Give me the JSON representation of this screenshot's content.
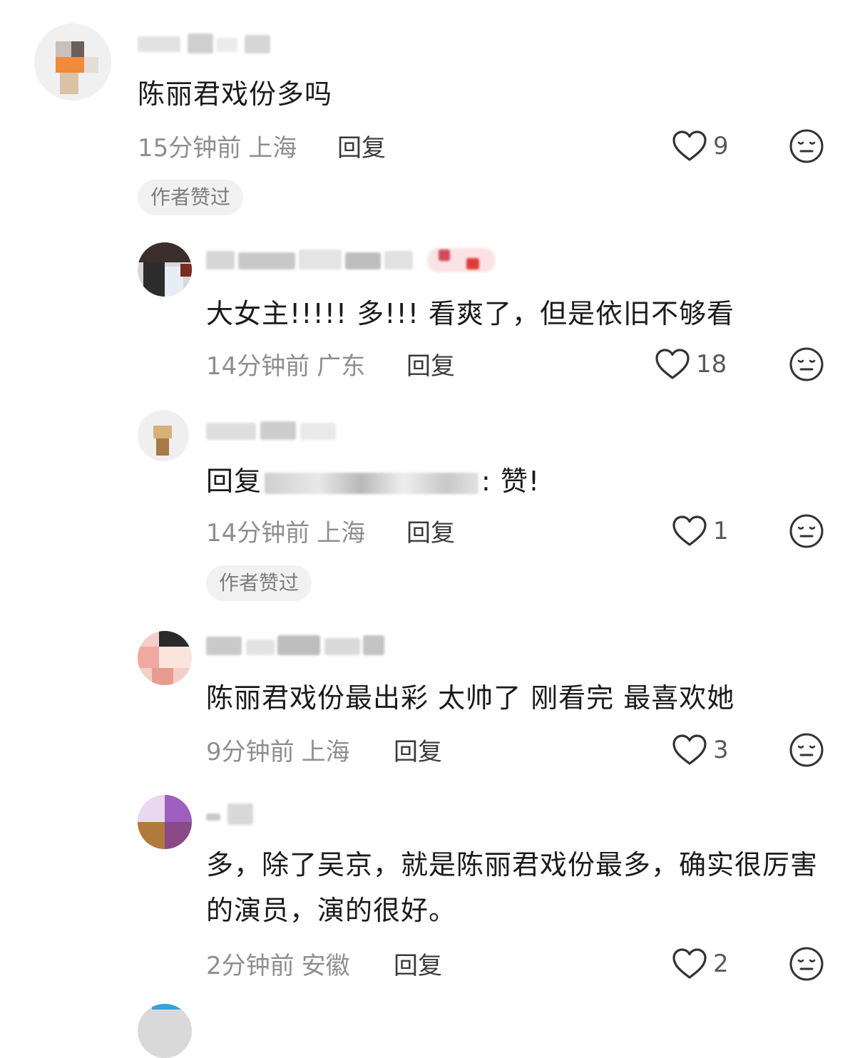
{
  "comments": [
    {
      "content": "陈丽君戏份多吗",
      "time": "15分钟前",
      "location": "上海",
      "reply_label": "回复",
      "likes": "9",
      "badge": "作者赞过"
    },
    {
      "content": "大女主!!!!!  多!!!  看爽了，但是依旧不够看",
      "time": "14分钟前",
      "location": "广东",
      "reply_label": "回复",
      "likes": "18"
    },
    {
      "content_prefix": "回复",
      "content_suffix": ": 赞!",
      "time": "14分钟前",
      "location": "上海",
      "reply_label": "回复",
      "likes": "1",
      "badge": "作者赞过"
    },
    {
      "content": "陈丽君戏份最出彩 太帅了 刚看完 最喜欢她",
      "time": "9分钟前",
      "location": "上海",
      "reply_label": "回复",
      "likes": "3"
    },
    {
      "content": "多，除了吴京，就是陈丽君戏份最多，确实很厉害的演员，演的很好。",
      "time": "2分钟前",
      "location": "安徽",
      "reply_label": "回复",
      "likes": "2"
    }
  ],
  "icons": {
    "like": "heart-outline-icon",
    "emoji": "neutral-face-icon"
  },
  "colors": {
    "text": "#1b1b1b",
    "meta": "#8e8e8e",
    "badge_bg": "#f1f1f1",
    "badge_text": "#7d7d7d"
  }
}
